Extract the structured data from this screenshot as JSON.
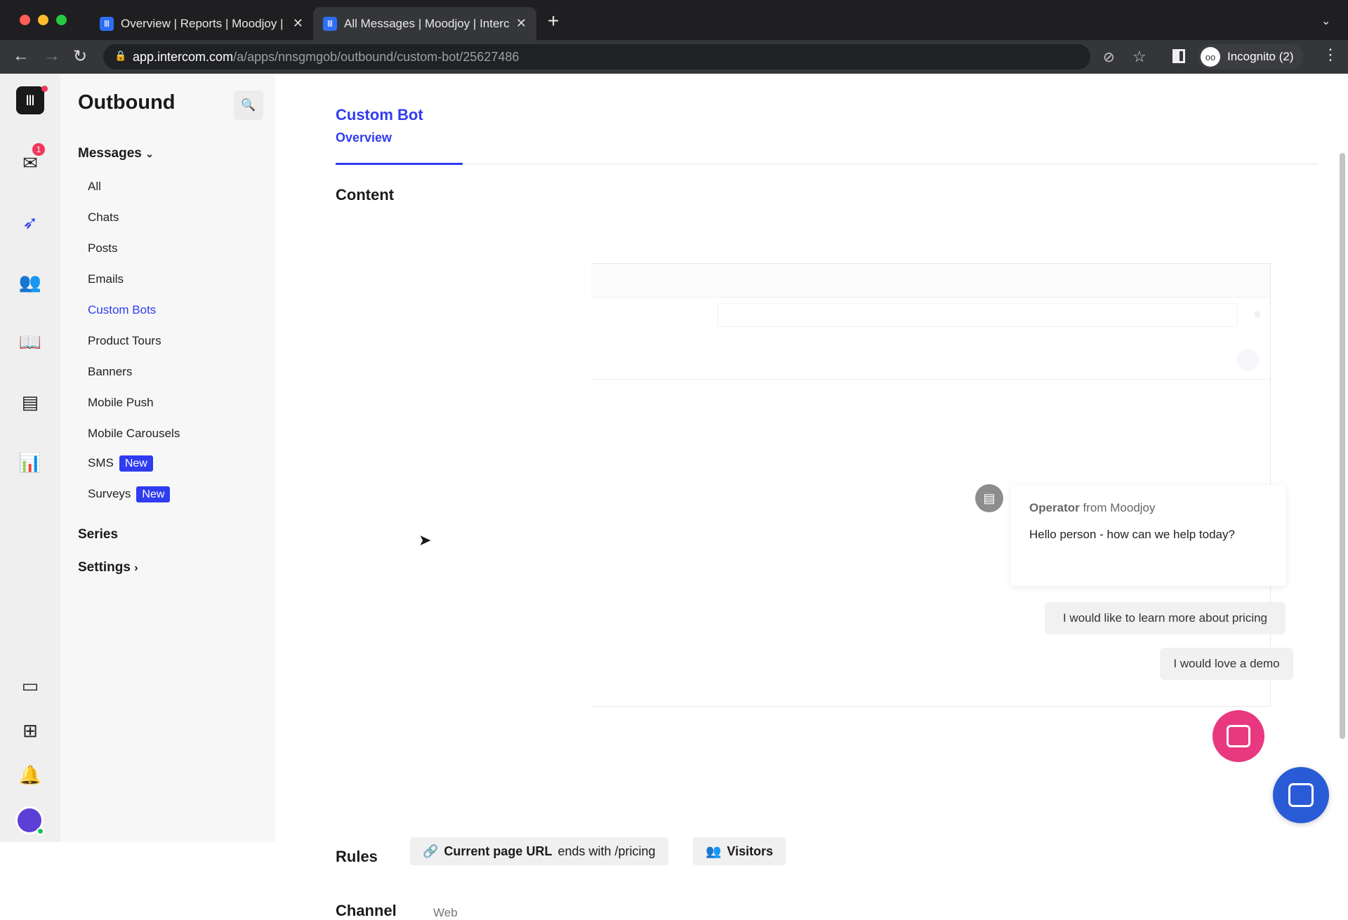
{
  "browser": {
    "tabs": [
      {
        "title": "Overview | Reports | Moodjoy |",
        "active": false
      },
      {
        "title": "All Messages | Moodjoy | Interc",
        "active": true
      }
    ],
    "url_host": "app.intercom.com",
    "url_path": "/a/apps/nnsgmgob/outbound/custom-bot/25627486",
    "profile": "Incognito (2)"
  },
  "rail": {
    "inbox_badge": "1"
  },
  "nav": {
    "title": "Outbound",
    "messages_label": "Messages",
    "items": [
      {
        "label": "All"
      },
      {
        "label": "Chats"
      },
      {
        "label": "Posts"
      },
      {
        "label": "Emails"
      },
      {
        "label": "Custom Bots",
        "active": true
      },
      {
        "label": "Product Tours"
      },
      {
        "label": "Banners"
      },
      {
        "label": "Mobile Push"
      },
      {
        "label": "Mobile Carousels"
      },
      {
        "label": "SMS",
        "badge": "New"
      },
      {
        "label": "Surveys",
        "badge": "New"
      }
    ],
    "series_label": "Series",
    "settings_label": "Settings"
  },
  "header": {
    "title": "Custom Bot",
    "tab": "Overview"
  },
  "content": {
    "heading": "Content",
    "operator_name": "Operator",
    "operator_from": "from Moodjoy",
    "message": "Hello person - how can we help today?",
    "replies": [
      "I would like to learn more about pricing",
      "I would love a demo"
    ]
  },
  "rules": {
    "label": "Rules",
    "url_rule_bold": "Current page URL",
    "url_rule_rest": "ends with /pricing",
    "audience": "Visitors"
  },
  "channel": {
    "label": "Channel",
    "value": "Web"
  },
  "colors": {
    "accent": "#2f3cf0",
    "launcher_pink": "#e8387f",
    "messenger_blue": "#2a5bd7"
  }
}
